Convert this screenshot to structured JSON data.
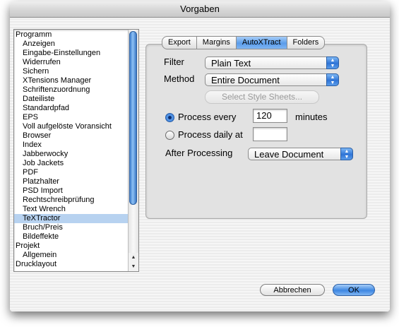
{
  "window": {
    "title": "Vorgaben"
  },
  "sidebar": {
    "items": [
      {
        "label": "Programm",
        "level": 0,
        "selected": false
      },
      {
        "label": "Anzeigen",
        "level": 1,
        "selected": false
      },
      {
        "label": "Eingabe-Einstellungen",
        "level": 1,
        "selected": false
      },
      {
        "label": "Widerrufen",
        "level": 1,
        "selected": false
      },
      {
        "label": "Sichern",
        "level": 1,
        "selected": false
      },
      {
        "label": "XTensions Manager",
        "level": 1,
        "selected": false
      },
      {
        "label": "Schriftenzuordnung",
        "level": 1,
        "selected": false
      },
      {
        "label": "Dateiliste",
        "level": 1,
        "selected": false
      },
      {
        "label": "Standardpfad",
        "level": 1,
        "selected": false
      },
      {
        "label": "EPS",
        "level": 1,
        "selected": false
      },
      {
        "label": "Voll aufgelöste Voransicht",
        "level": 1,
        "selected": false
      },
      {
        "label": "Browser",
        "level": 1,
        "selected": false
      },
      {
        "label": "Index",
        "level": 1,
        "selected": false
      },
      {
        "label": "Jabberwocky",
        "level": 1,
        "selected": false
      },
      {
        "label": "Job Jackets",
        "level": 1,
        "selected": false
      },
      {
        "label": "PDF",
        "level": 1,
        "selected": false
      },
      {
        "label": "Platzhalter",
        "level": 1,
        "selected": false
      },
      {
        "label": "PSD Import",
        "level": 1,
        "selected": false
      },
      {
        "label": "Rechtschreibprüfung",
        "level": 1,
        "selected": false
      },
      {
        "label": "Text Wrench",
        "level": 1,
        "selected": false
      },
      {
        "label": "TeXTractor",
        "level": 1,
        "selected": true
      },
      {
        "label": "Bruch/Preis",
        "level": 1,
        "selected": false
      },
      {
        "label": "Bildeffekte",
        "level": 1,
        "selected": false
      },
      {
        "label": "Projekt",
        "level": 0,
        "selected": false
      },
      {
        "label": "Allgemein",
        "level": 1,
        "selected": false
      },
      {
        "label": "Drucklayout",
        "level": 0,
        "selected": false
      }
    ]
  },
  "tabs": [
    {
      "label": "Export",
      "active": false
    },
    {
      "label": "Margins",
      "active": false
    },
    {
      "label": "AutoXTract",
      "active": true
    },
    {
      "label": "Folders",
      "active": false
    }
  ],
  "form": {
    "filter_label": "Filter",
    "filter_value": "Plain Text",
    "method_label": "Method",
    "method_value": "Entire Document",
    "select_style_sheets": "Select Style Sheets...",
    "process_every_label": "Process every",
    "process_every_value": "120",
    "process_every_selected": true,
    "minutes_label": "minutes",
    "process_daily_label": "Process daily at",
    "process_daily_value": "",
    "process_daily_selected": false,
    "after_processing_label": "After Processing",
    "after_processing_value": "Leave Document"
  },
  "buttons": {
    "cancel": "Abbrechen",
    "ok": "OK"
  },
  "colors": {
    "selection": "#b7d2f0",
    "accent_blue": "#3d87e2",
    "panel": "#e2e2e2"
  },
  "icons": {
    "popup_arrows": "up-down-arrows-icon",
    "scroll_up": "scroll-up-arrow-icon",
    "scroll_down": "scroll-down-arrow-icon"
  }
}
